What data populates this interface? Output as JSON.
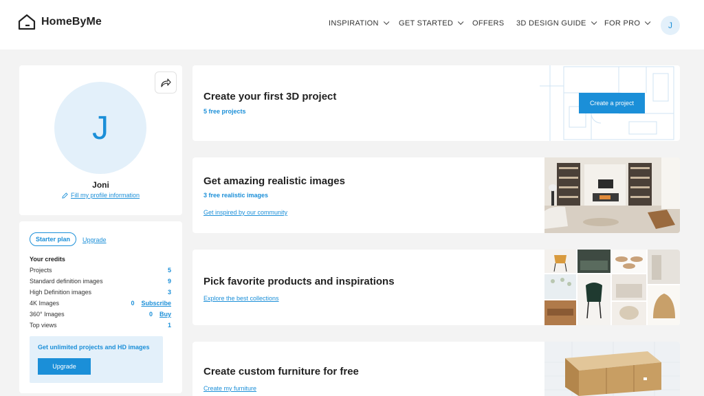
{
  "header": {
    "brand": "HomeByMe",
    "nav": [
      {
        "label": "INSPIRATION",
        "dropdown": true
      },
      {
        "label": "GET STARTED",
        "dropdown": true
      },
      {
        "label": "OFFERS",
        "dropdown": false
      },
      {
        "label": "3D DESIGN GUIDE",
        "dropdown": true
      },
      {
        "label": "FOR PRO",
        "dropdown": true
      }
    ],
    "avatar_initial": "J"
  },
  "profile": {
    "initial": "J",
    "name": "Joni",
    "edit_link": "Fill my profile information"
  },
  "credits": {
    "plan": "Starter plan",
    "upgrade_link": "Upgrade",
    "title": "Your credits",
    "rows": [
      {
        "label": "Projects",
        "value": "5",
        "action": ""
      },
      {
        "label": "Standard definition images",
        "value": "9",
        "action": ""
      },
      {
        "label": "High Definition images",
        "value": "3",
        "action": ""
      },
      {
        "label": "4K Images",
        "value": "0",
        "action": "Subscribe"
      },
      {
        "label": "360° Images",
        "value": "0",
        "action": "Buy"
      },
      {
        "label": "Top views",
        "value": "1",
        "action": ""
      }
    ],
    "promo_text": "Get unlimited projects and HD images",
    "promo_button": "Upgrade"
  },
  "cards": {
    "project": {
      "title": "Create your first 3D project",
      "subtitle": "5 free projects",
      "button": "Create a project"
    },
    "images": {
      "title": "Get amazing realistic images",
      "subtitle": "3 free realistic images",
      "link": "Get inspired by our community"
    },
    "products": {
      "title": "Pick favorite products and inspirations",
      "link": "Explore the best collections"
    },
    "furniture": {
      "title": "Create custom furniture for free",
      "link": "Create my furniture"
    }
  },
  "colors": {
    "accent": "#1b8fd8",
    "accent_light": "#e3f0fa",
    "background": "#f3f3f3"
  },
  "icons": {
    "logo": "house-outline-icon",
    "share": "share-arrow-icon",
    "edit": "pencil-icon",
    "dropdown": "chevron-down-icon"
  }
}
